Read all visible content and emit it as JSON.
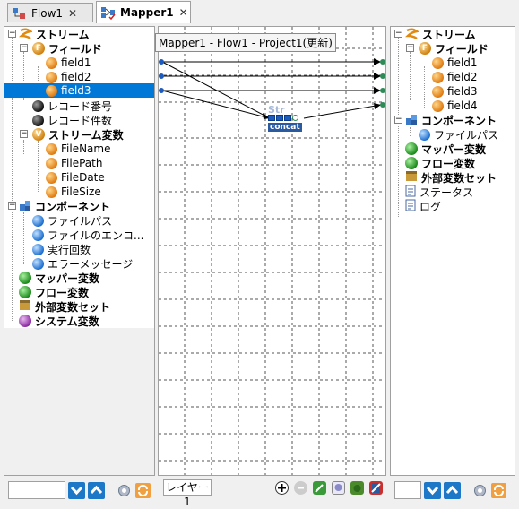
{
  "tabs": [
    {
      "label": "Flow1",
      "close": "✕"
    },
    {
      "label": "Mapper1",
      "close": "✕"
    }
  ],
  "tooltip": "Mapper1 - Flow1 - Project1(更新)",
  "left_tree": {
    "stream": "ストリーム",
    "fields": "フィールド",
    "field1": "field1",
    "field2": "field2",
    "field3": "field3",
    "record_number": "レコード番号",
    "record_count": "レコード件数",
    "stream_vars": "ストリーム変数",
    "file_name": "FileName",
    "file_path": "FilePath",
    "file_date": "FileDate",
    "file_size": "FileSize",
    "component": "コンポーネント",
    "c_file_path": "ファイルパス",
    "c_file_encoding": "ファイルのエンコ...",
    "c_exec_count": "実行回数",
    "c_error_message": "エラーメッセージ",
    "mapper_vars": "マッパー変数",
    "flow_vars": "フロー変数",
    "ext_var_set": "外部変数セット",
    "system_vars": "システム変数"
  },
  "right_tree": {
    "stream": "ストリーム",
    "fields": "フィールド",
    "field1": "field1",
    "field2": "field2",
    "field3": "field3",
    "field4": "field4",
    "component": "コンポーネント",
    "c_file_path": "ファイルパス",
    "mapper_vars": "マッパー変数",
    "flow_vars": "フロー変数",
    "ext_var_set": "外部変数セット",
    "status": "ステータス",
    "log": "ログ"
  },
  "canvas": {
    "node_title": "Str",
    "node_label": "concat",
    "layer_tab": "レイヤー1"
  },
  "colors": {
    "selection": "#0078d7",
    "node_blue": "#1e5bbf",
    "connector_green": "#2e8b57"
  }
}
